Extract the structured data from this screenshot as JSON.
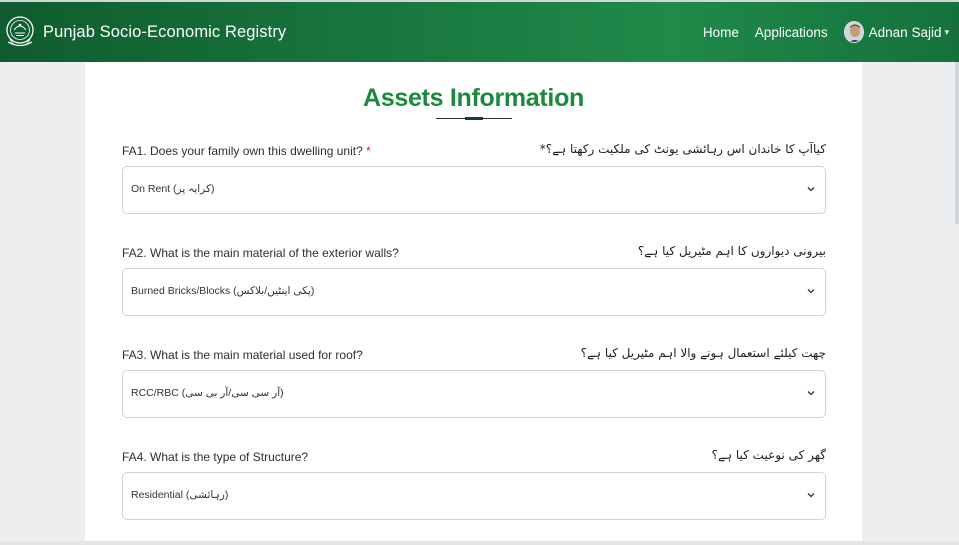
{
  "navbar": {
    "brand_title": "Punjab Socio-Economic Registry",
    "links": [
      "Home",
      "Applications"
    ],
    "user_name": "Adnan Sajid",
    "caret": "▾"
  },
  "page": {
    "title": "Assets Information"
  },
  "questions": [
    {
      "label": "FA1. Does your family own this dwelling unit?",
      "required_mark": "*",
      "urdu": "کیاآپ کا خاندان اس رہائشی یونٹ کی ملکیت رکھتا ہے؟*",
      "value": "On Rent (کرایہ پر)"
    },
    {
      "label": "FA2. What is the main material of the exterior walls?",
      "required_mark": "",
      "urdu": "بیرونی دیواروں کا اہم مٹیریل کیا ہے؟",
      "value": "Burned Bricks/Blocks (پکی اینٹیں/بلاکس)"
    },
    {
      "label": "FA3. What is the main material used for roof?",
      "required_mark": "",
      "urdu": "چھت کیلئے استعمال ہونے والا اہم مٹیریل کیا ہے؟",
      "value": "RCC/RBC (آر سی سی/آر بی سی)"
    },
    {
      "label": "FA4. What is the type of Structure?",
      "required_mark": "",
      "urdu": "گھر کی نوعیت کیا ہے؟",
      "value": "Residential (رہائشی)"
    }
  ],
  "icons": {
    "logo": "punjab-government-emblem",
    "dropdown": "chevron-down-icon"
  },
  "colors": {
    "navbar_green": "#1a7a40",
    "title_green": "#1b8a3c",
    "required_red": "#dd2222"
  }
}
